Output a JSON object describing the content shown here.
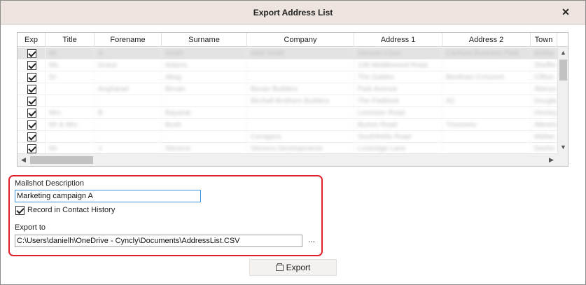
{
  "window": {
    "title": "Export Address List",
    "close_glyph": "✕"
  },
  "grid": {
    "columns": [
      "Exp",
      "Title",
      "Forename",
      "Surname",
      "Company",
      "Address 1",
      "Address 2",
      "Town"
    ],
    "rows": [
      {
        "checked": true,
        "cells": [
          "Mr",
          "A",
          "Smith",
          "A&B Smith",
          "Nerwan Court",
          "Carthew Business Park",
          "Ashbu"
        ]
      },
      {
        "checked": true,
        "cells": [
          "Ms",
          "Grace",
          "Adams",
          "",
          "139 Middlewood Road",
          "",
          "Sheffie"
        ]
      },
      {
        "checked": true,
        "cells": [
          "Dr",
          "",
          "Akag",
          "",
          "The Gables",
          "Beotham Crescent",
          "Clifton"
        ]
      },
      {
        "checked": true,
        "cells": [
          "",
          "Angharad",
          "Bevan",
          "Bevan Builders",
          "Park Avenue",
          "",
          "Aberyst"
        ]
      },
      {
        "checked": true,
        "cells": [
          "",
          "",
          "",
          "Birchall Brothers Builders",
          "The Paddock",
          "A2",
          "Dougla"
        ]
      },
      {
        "checked": true,
        "cells": [
          "Mrs",
          "B",
          "Bayanai",
          "",
          "Leicester Road",
          "",
          "Hincley"
        ]
      },
      {
        "checked": true,
        "cells": [
          "Mr & Mrs",
          "",
          "Bush",
          "",
          "Burton Road",
          "Trivonnes",
          "Alleston"
        ]
      },
      {
        "checked": true,
        "cells": [
          "",
          "",
          "",
          "Corrigans",
          "Southfields Road",
          "",
          "Midlan"
        ]
      },
      {
        "checked": true,
        "cells": [
          "Mr",
          "J",
          "Stevens",
          "Stevens Developments",
          "Lockridge Lane",
          "",
          "Deefor"
        ]
      }
    ]
  },
  "panel": {
    "mailshot_label": "Mailshot Description",
    "mailshot_value": "Marketing campaign A",
    "record_history_label": "Record in Contact History",
    "record_history_checked": true,
    "export_to_label": "Export to",
    "export_path": "C:\\Users\\danielh\\OneDrive - Cyncly\\Documents\\AddressList.CSV",
    "browse_label": "..."
  },
  "export_button": {
    "label": "Export"
  },
  "colors": {
    "highlight_border": "#e0202a",
    "titlebar": "#ede4e0",
    "focus_border": "#3a8fd6"
  }
}
